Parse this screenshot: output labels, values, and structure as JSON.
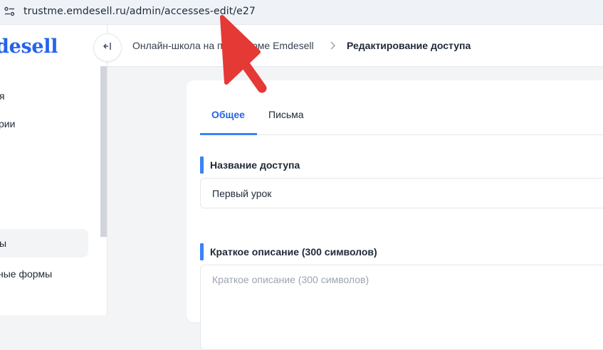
{
  "browser": {
    "url": "trustme.emdesell.ru/admin/accesses-edit/e27"
  },
  "sidebar": {
    "logo": "desell",
    "items": [
      {
        "label": "я",
        "active": false
      },
      {
        "label": "рии",
        "active": false
      },
      {
        "label": "ы",
        "active": true
      },
      {
        "label": "ные формы",
        "active": false
      }
    ]
  },
  "breadcrumb": {
    "parent": "Онлайн-школа на платформе Emdesell",
    "current": "Редактирование доступа"
  },
  "tabs": [
    {
      "label": "Общее",
      "active": true
    },
    {
      "label": "Письма",
      "active": false
    }
  ],
  "form": {
    "name_label": "Название доступа",
    "name_value": "Первый урок",
    "desc_label": "Краткое описание (300 символов)",
    "desc_placeholder": "Краткое описание (300 символов)"
  },
  "colors": {
    "accent": "#3b82f6",
    "logo": "#2563eb",
    "annotation_arrow": "#e53935"
  }
}
